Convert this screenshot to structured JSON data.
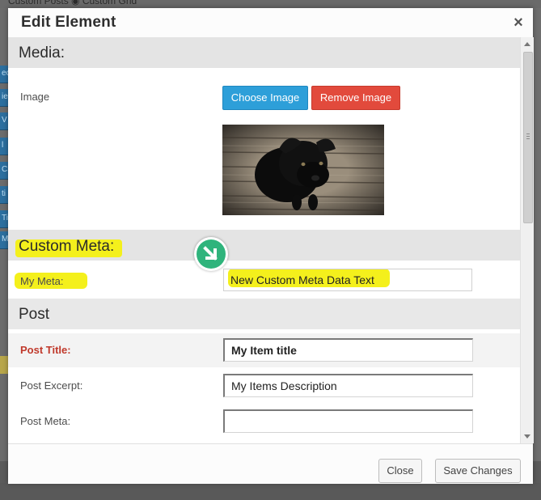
{
  "background": {
    "top_text": "Custom Posts   ◉ Custom Grid",
    "left_tabs": [
      "ec",
      "ie",
      "V",
      "l",
      "Cl",
      "ti",
      "Ti",
      "St",
      "M"
    ]
  },
  "modal": {
    "title": "Edit Element",
    "close_glyph": "×",
    "sections": {
      "media": {
        "heading": "Media:",
        "image_label": "Image",
        "choose_button": "Choose Image",
        "remove_button": "Remove Image"
      },
      "custom_meta": {
        "heading": "Custom Meta:",
        "my_meta_label": "My Meta:",
        "my_meta_value": "New Custom Meta Data Text"
      },
      "post": {
        "heading": "Post",
        "title_label": "Post Title:",
        "title_value": "My Item title",
        "excerpt_label": "Post Excerpt:",
        "excerpt_value": "My Items Description",
        "meta_label": "Post Meta:",
        "meta_value": ""
      }
    },
    "footer": {
      "close_button": "Close",
      "save_button": "Save Changes"
    }
  },
  "colors": {
    "accent_blue": "#2d9fd9",
    "accent_red": "#e24a3c",
    "highlight": "#f4f01c",
    "arrow_green": "#2fb47c",
    "required_label": "#c0392b"
  },
  "icons": {
    "close": "close-icon",
    "arrow": "arrow-down-right-icon",
    "image": "dog-photo-thumbnail"
  }
}
